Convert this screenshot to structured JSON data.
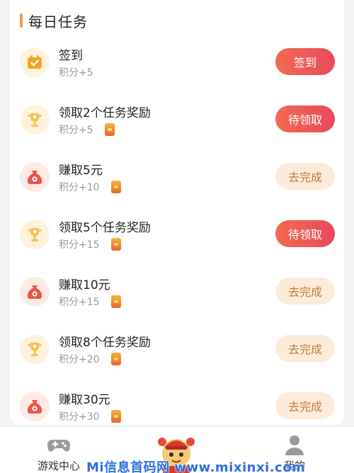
{
  "section": {
    "title": "每日任务"
  },
  "tasks": [
    {
      "name": "签到",
      "points": "积分+5",
      "button": "签到",
      "button_style": "primary",
      "icon": "calendar-check-icon",
      "has_badge": false
    },
    {
      "name": "领取2个任务奖励",
      "points": "积分+5",
      "button": "待领取",
      "button_style": "primary",
      "icon": "trophy-icon",
      "has_badge": true
    },
    {
      "name": "赚取5元",
      "points": "积分+10",
      "button": "去完成",
      "button_style": "soft",
      "icon": "money-bag-icon",
      "has_badge": true
    },
    {
      "name": "领取5个任务奖励",
      "points": "积分+15",
      "button": "待领取",
      "button_style": "primary",
      "icon": "trophy-icon",
      "has_badge": true
    },
    {
      "name": "赚取10元",
      "points": "积分+15",
      "button": "去完成",
      "button_style": "soft",
      "icon": "money-bag-icon",
      "has_badge": true
    },
    {
      "name": "领取8个任务奖励",
      "points": "积分+20",
      "button": "去完成",
      "button_style": "soft",
      "icon": "trophy-icon",
      "has_badge": true
    },
    {
      "name": "赚取30元",
      "points": "积分+30",
      "button": "去完成",
      "button_style": "soft",
      "icon": "money-bag-icon",
      "has_badge": true
    }
  ],
  "tabbar": {
    "left_label": "游戏中心",
    "right_label": "我的"
  },
  "watermark": "Mi信息首码网 www.mixinxi.com",
  "colors": {
    "accent": "#f09a4a",
    "primary_button": "#ec5858",
    "soft_button": "#fcebd8",
    "soft_button_text": "#c47a42"
  }
}
